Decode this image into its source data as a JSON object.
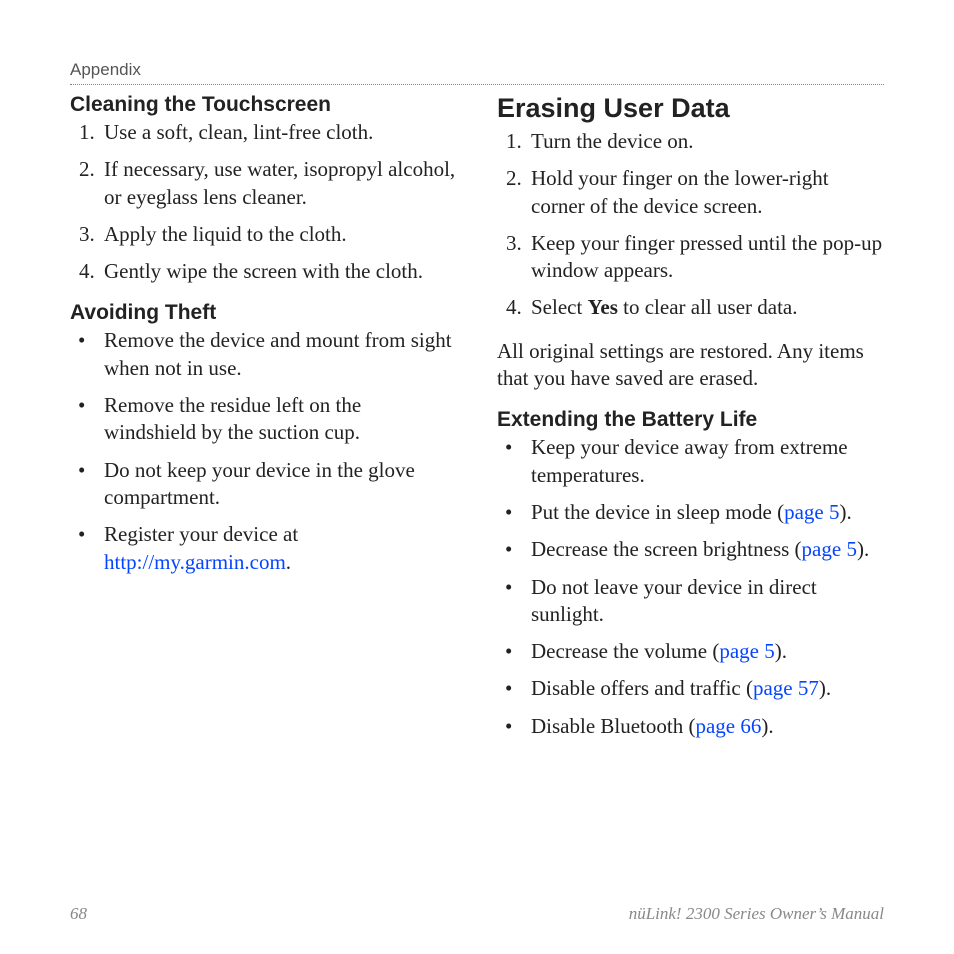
{
  "runningHead": "Appendix",
  "left": {
    "heading1": "Cleaning the Touchscreen",
    "ol1": [
      "Use a soft, clean, lint-free cloth.",
      "If necessary, use water, isopropyl alcohol, or eyeglass lens cleaner.",
      "Apply the liquid to the cloth.",
      "Gently wipe the screen with the cloth."
    ],
    "heading2": "Avoiding Theft",
    "ul1": {
      "i1": "Remove the device and mount from sight when not in use.",
      "i2": "Remove the residue left on the windshield by the suction cup.",
      "i3": "Do not keep your device in the glove compartment.",
      "i4_pre": "Register your device at ",
      "i4_link": "http://my.garmin.com",
      "i4_post": "."
    }
  },
  "right": {
    "heading1": "Erasing User Data",
    "ol1": {
      "i1": "Turn the device on.",
      "i2": "Hold your finger on the lower-right corner of the device screen.",
      "i3": "Keep your finger pressed until the pop-up window appears.",
      "i4_pre": "Select ",
      "i4_bold": "Yes",
      "i4_post": " to clear all user data."
    },
    "para1": "All original settings are restored. Any items that you have saved are erased.",
    "heading2": "Extending the Battery Life",
    "ul1": {
      "i1": "Keep your device away from extreme temperatures.",
      "i2_pre": "Put the device in sleep mode (",
      "i2_link": "page 5",
      "i2_post": ").",
      "i3_pre": "Decrease the screen brightness (",
      "i3_link": "page 5",
      "i3_post": ").",
      "i4": "Do not leave your device in direct sunlight.",
      "i5_pre": "Decrease the volume (",
      "i5_link": "page 5",
      "i5_post": ").",
      "i6_pre": "Disable offers and traffic (",
      "i6_link": "page 57",
      "i6_post": ").",
      "i7_pre": "Disable Bluetooth (",
      "i7_link": "page 66",
      "i7_post": ")."
    }
  },
  "footer": {
    "pageNum": "68",
    "manual": "nüLink! 2300 Series Owner’s Manual"
  }
}
